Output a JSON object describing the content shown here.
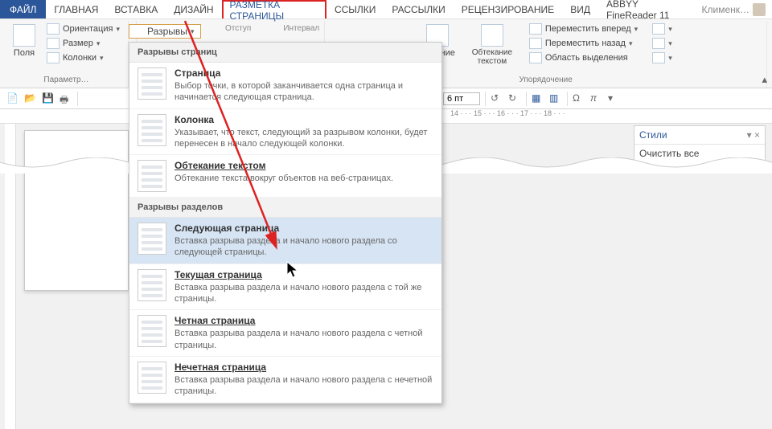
{
  "tabs": {
    "file": "ФАЙЛ",
    "items": [
      "ГЛАВНАЯ",
      "ВСТАВКА",
      "ДИЗАЙН",
      "РАЗМЕТКА СТРАНИЦЫ",
      "ССЫЛКИ",
      "РАССЫЛКИ",
      "РЕЦЕНЗИРОВАНИЕ",
      "ВИД",
      "ABBYY FineReader 11"
    ],
    "active_index": 3,
    "user": "Клименк…"
  },
  "ribbon": {
    "margins": "Поля",
    "orientation": "Ориентация",
    "size": "Размер",
    "columns": "Колонки",
    "breaks": "Разрывы",
    "page_setup_label": "Параметр…",
    "indent_label": "Отступ",
    "spacing_label": "Интервал",
    "position": "ложение",
    "wrap_text": "Обтекание текстом",
    "bring_forward": "Переместить вперед",
    "send_backward": "Переместить назад",
    "selection_pane": "Область выделения",
    "arrange_label": "Упорядочение",
    "spin_value": "6 пт"
  },
  "styles_pane": {
    "title": "Стили",
    "clear": "Очистить все"
  },
  "dropdown": {
    "section1": "Разрывы страниц",
    "section2": "Разрывы разделов",
    "items1": [
      {
        "title": "Страница",
        "desc": "Выбор точки, в которой заканчивается одна страница и начинается следующая страница."
      },
      {
        "title": "Колонка",
        "desc": "Указывает, что текст, следующий за разрывом колонки, будет перенесен в начало следующей колонки."
      },
      {
        "title": "Обтекание текстом",
        "desc": "Обтекание текста вокруг объектов на веб-страницах."
      }
    ],
    "items2": [
      {
        "title": "Следующая страница",
        "desc": "Вставка разрыва раздела и начало нового раздела со следующей страницы."
      },
      {
        "title": "Текущая страница",
        "desc": "Вставка разрыва раздела и начало нового раздела с той же страницы."
      },
      {
        "title": "Четная страница",
        "desc": "Вставка разрыва раздела и начало нового раздела с четной страницы."
      },
      {
        "title": "Нечетная страница",
        "desc": "Вставка разрыва раздела и начало нового раздела с нечетной страницы."
      }
    ],
    "hover_index2": 0
  },
  "ruler_text": "14 · · · 15 · · · 16 · · · 17 · · · 18 · · ·"
}
